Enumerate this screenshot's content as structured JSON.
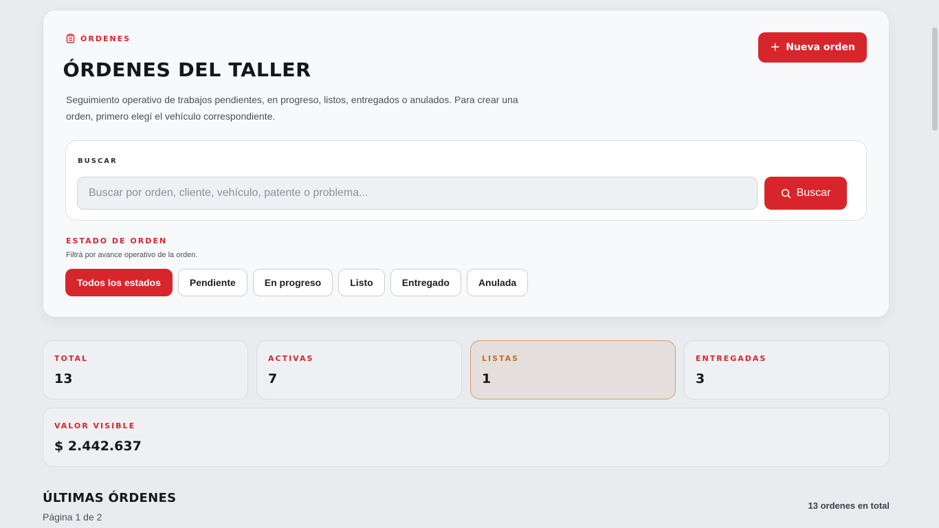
{
  "header": {
    "eyebrow": "ÓRDENES",
    "title": "ÓRDENES DEL TALLER",
    "description": "Seguimiento operativo de trabajos pendientes, en progreso, listos, entregados o anulados. Para crear una orden, primero elegí el vehículo correspondiente.",
    "new_button": "Nueva orden"
  },
  "search": {
    "label": "BUSCAR",
    "placeholder": "Buscar por orden, cliente, vehículo, patente o problema...",
    "button": "Buscar"
  },
  "filter": {
    "title": "ESTADO DE ORDEN",
    "subtitle": "Filtrá por avance operativo de la orden.",
    "chips": [
      {
        "label": "Todos los estados",
        "active": true
      },
      {
        "label": "Pendiente",
        "active": false
      },
      {
        "label": "En progreso",
        "active": false
      },
      {
        "label": "Listo",
        "active": false
      },
      {
        "label": "Entregado",
        "active": false
      },
      {
        "label": "Anulada",
        "active": false
      }
    ]
  },
  "stats": {
    "total": {
      "label": "TOTAL",
      "value": "13"
    },
    "activas": {
      "label": "ACTIVAS",
      "value": "7"
    },
    "listas": {
      "label": "LISTAS",
      "value": "1"
    },
    "entregadas": {
      "label": "ENTREGADAS",
      "value": "3"
    },
    "valor": {
      "label": "VALOR VISIBLE",
      "value": "$ 2.442.637"
    }
  },
  "latest": {
    "title": "ÚLTIMAS ÓRDENES",
    "page": "Página 1 de 2",
    "count": "13 ordenes en total"
  },
  "colors": {
    "accent": "#d7262b",
    "highlight_border": "#d99a6a",
    "highlight_label": "#c76a1f"
  }
}
